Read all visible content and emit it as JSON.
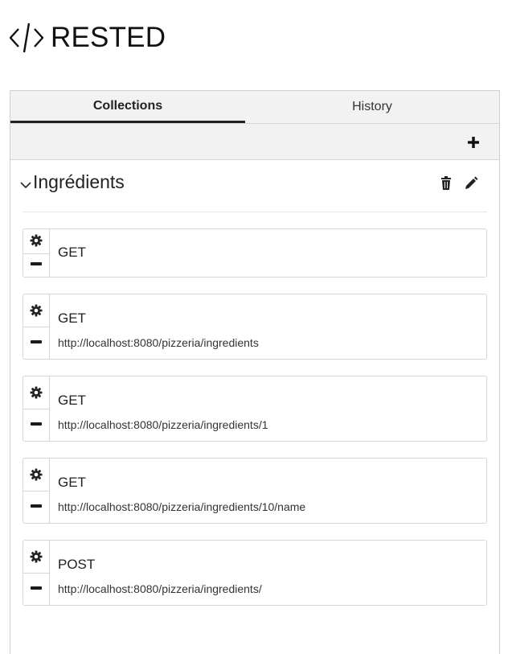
{
  "app": {
    "title": "RESTED",
    "logo_icon": "code-brackets-icon"
  },
  "tabs": [
    {
      "label": "Collections",
      "active": true
    },
    {
      "label": "History",
      "active": false
    }
  ],
  "toolbar": {
    "add_icon": "plus-icon"
  },
  "collection": {
    "name": "Ingrédients",
    "expanded": true,
    "actions": [
      "trash-icon",
      "pencil-icon"
    ],
    "requests": [
      {
        "method": "GET",
        "url": ""
      },
      {
        "method": "GET",
        "url": "http://localhost:8080/pizzeria/ingredients"
      },
      {
        "method": "GET",
        "url": "http://localhost:8080/pizzeria/ingredients/1"
      },
      {
        "method": "GET",
        "url": "http://localhost:8080/pizzeria/ingredients/10/name"
      },
      {
        "method": "POST",
        "url": "http://localhost:8080/pizzeria/ingredients/"
      }
    ]
  },
  "colors": {
    "accent": "#222222",
    "border": "#d6d6d6",
    "toolbar_bg": "#f2f2f2"
  }
}
